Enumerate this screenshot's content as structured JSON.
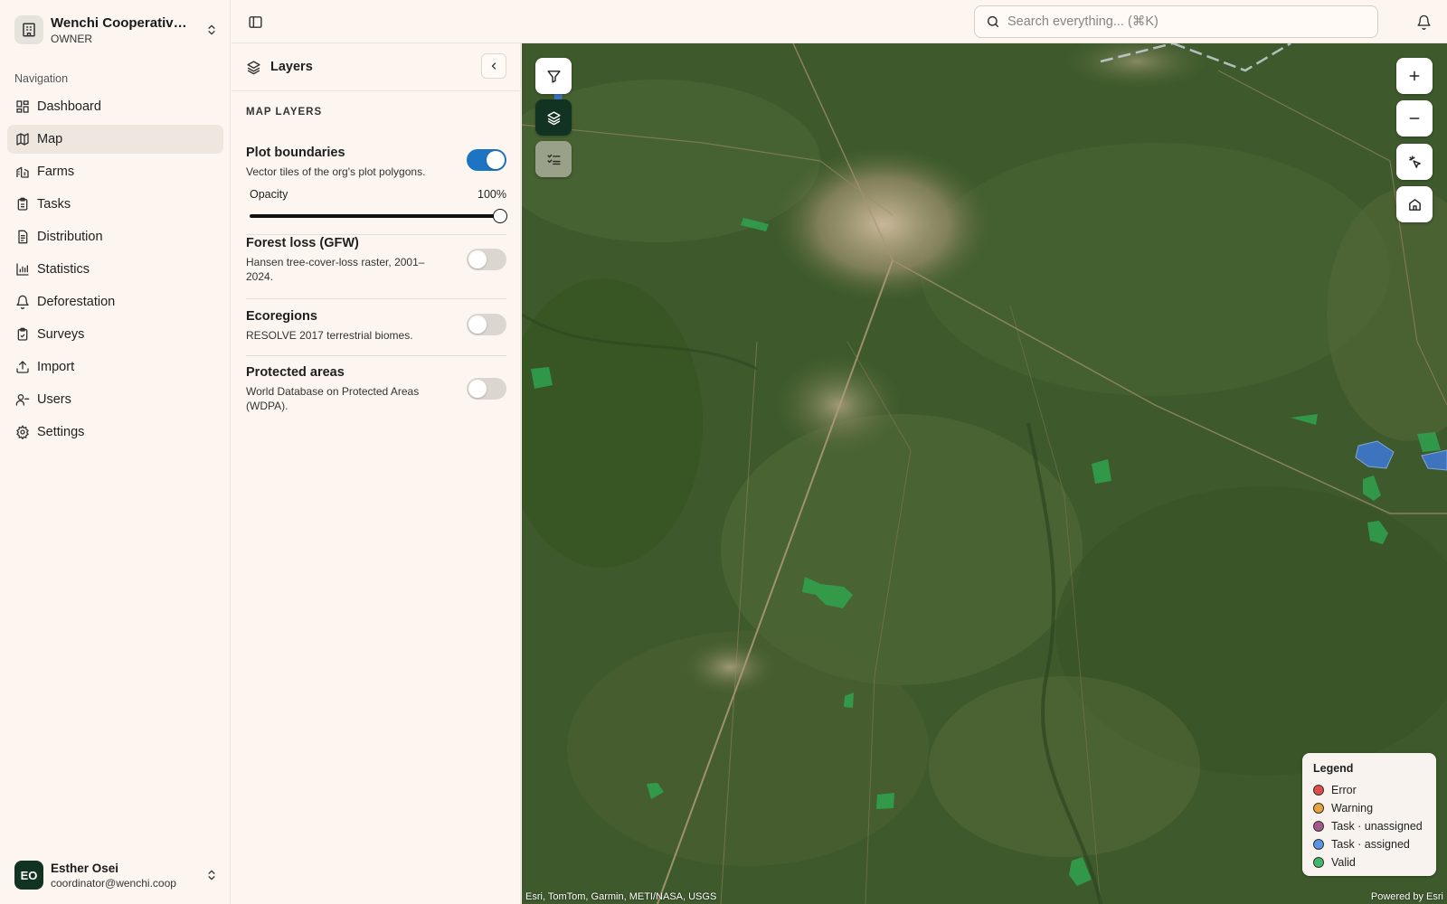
{
  "org": {
    "name": "Wenchi Cooperative Union",
    "role": "OWNER"
  },
  "nav": {
    "label": "Navigation",
    "items": [
      {
        "label": "Dashboard",
        "icon": "dashboard-icon"
      },
      {
        "label": "Map",
        "icon": "map-icon",
        "active": true
      },
      {
        "label": "Farms",
        "icon": "farms-icon"
      },
      {
        "label": "Tasks",
        "icon": "tasks-icon"
      },
      {
        "label": "Distribution",
        "icon": "distribution-icon"
      },
      {
        "label": "Statistics",
        "icon": "statistics-icon"
      },
      {
        "label": "Deforestation",
        "icon": "deforestation-icon"
      },
      {
        "label": "Surveys",
        "icon": "surveys-icon"
      },
      {
        "label": "Import",
        "icon": "import-icon"
      },
      {
        "label": "Users",
        "icon": "users-icon"
      },
      {
        "label": "Settings",
        "icon": "settings-icon"
      }
    ]
  },
  "user": {
    "initials": "EO",
    "name": "Esther Osei",
    "email": "coordinator@wenchi.coop"
  },
  "search": {
    "placeholder": "Search everything... (⌘K)"
  },
  "layers": {
    "title": "Layers",
    "section": "MAP LAYERS",
    "items": [
      {
        "title": "Plot boundaries",
        "desc": "Vector tiles of the org's plot polygons.",
        "enabled": true
      },
      {
        "title": "Forest loss (GFW)",
        "desc": "Hansen tree-cover-loss raster, 2001–2024.",
        "enabled": false
      },
      {
        "title": "Ecoregions",
        "desc": "RESOLVE 2017 terrestrial biomes.",
        "enabled": false
      },
      {
        "title": "Protected areas",
        "desc": "World Database on Protected Areas (WDPA).",
        "enabled": false
      }
    ],
    "opacity": {
      "label": "Opacity",
      "value": "100%",
      "fraction": 1.0
    }
  },
  "map": {
    "attribution": "Esri, TomTom, Garmin, METI/NASA, USGS",
    "powered": "Powered by Esri",
    "legend": {
      "title": "Legend",
      "items": [
        {
          "label": "Error",
          "color": "#e14b4b"
        },
        {
          "label": "Warning",
          "color": "#e8a23a"
        },
        {
          "label": "Task · unassigned",
          "color": "#a35a8a"
        },
        {
          "label": "Task · assigned",
          "color": "#5b93e6"
        },
        {
          "label": "Valid",
          "color": "#3fb86b"
        }
      ]
    }
  },
  "colors": {
    "brand_dark": "#123321",
    "toggle_on": "#1d74c2",
    "plot_green": "#2fa34f",
    "plot_blue": "#3f78d8"
  }
}
